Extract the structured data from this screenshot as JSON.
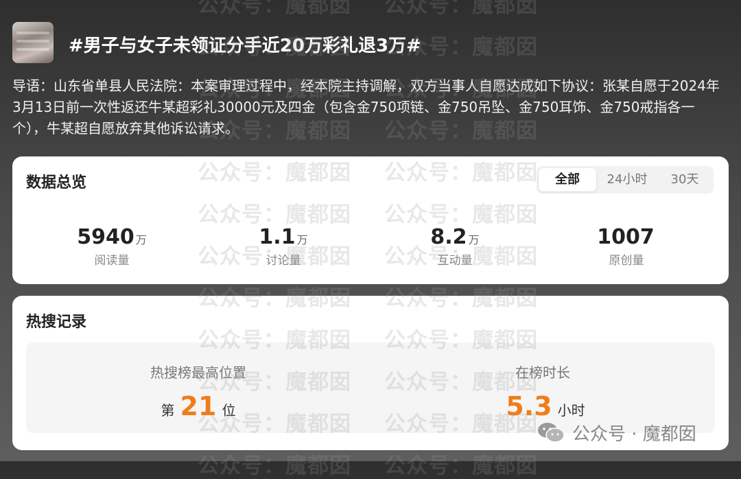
{
  "topic": {
    "title": "#男子与女子未领证分手近20万彩礼退3万#",
    "intro": "导语：山东省单县人民法院：本案审理过程中，经本院主持调解，双方当事人自愿达成如下协议：张某自愿于2024年3月13日前一次性返还牛某超彩礼30000元及四金（包含金750项链、金750吊坠、金750耳饰、金750戒指各一个），牛某超自愿放弃其他诉讼请求。"
  },
  "overview": {
    "title": "数据总览",
    "tabs": [
      {
        "label": "全部",
        "active": true
      },
      {
        "label": "24小时",
        "active": false
      },
      {
        "label": "30天",
        "active": false
      }
    ],
    "stats": [
      {
        "value": "5940",
        "unit": "万",
        "label": "阅读量"
      },
      {
        "value": "1.1",
        "unit": "万",
        "label": "讨论量"
      },
      {
        "value": "8.2",
        "unit": "万",
        "label": "互动量"
      },
      {
        "value": "1007",
        "unit": "",
        "label": "原创量"
      }
    ]
  },
  "hot": {
    "title": "热搜记录",
    "peak": {
      "label": "热搜榜最高位置",
      "prefix": "第",
      "value": "21",
      "suffix": "位"
    },
    "duration": {
      "label": "在榜时长",
      "value": "5.3",
      "suffix": "小时"
    }
  },
  "watermark": {
    "text": "公众号：魔都囡"
  },
  "badge": {
    "text": "公众号 · 魔都囡",
    "icon": "wechat-icon"
  },
  "colors": {
    "accent": "#f07d1a",
    "card": "#ffffff",
    "page_dark": "#2e2e2e"
  }
}
